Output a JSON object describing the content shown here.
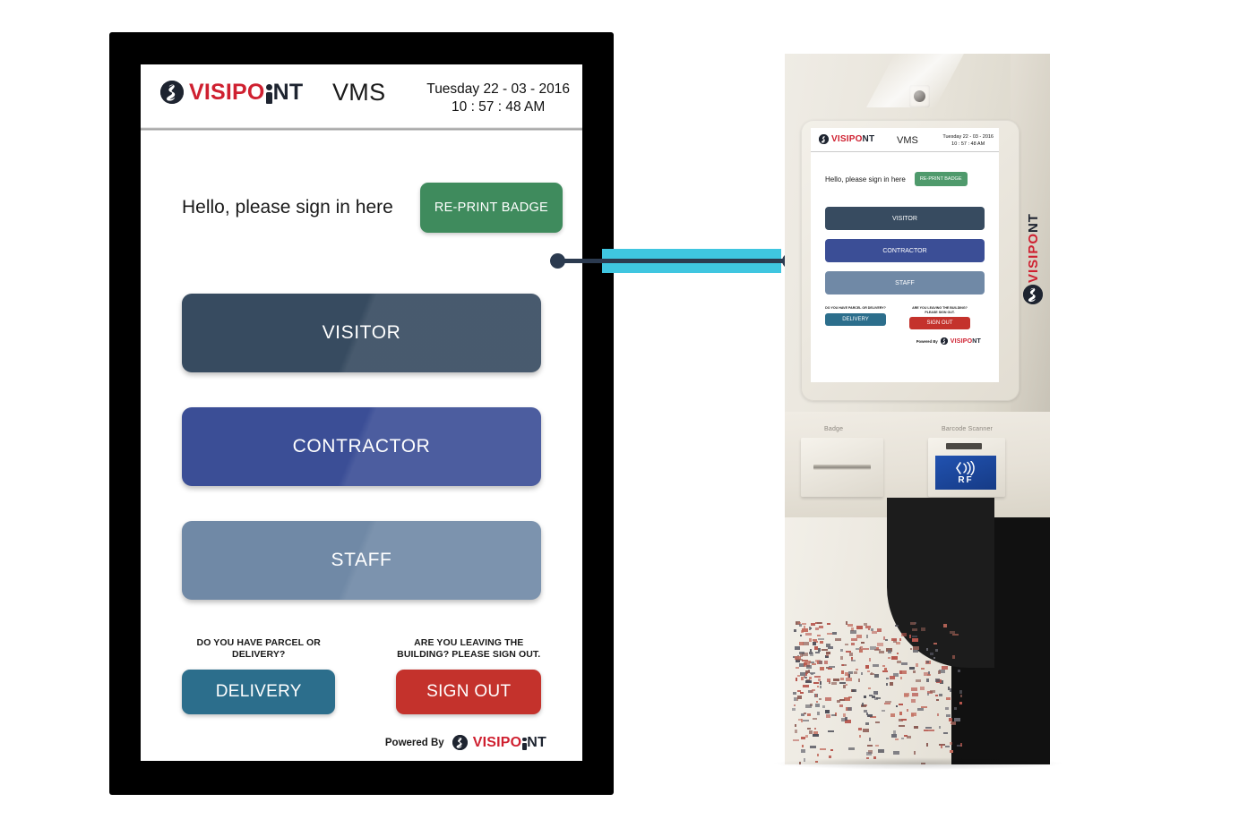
{
  "brand": {
    "name_part_red": "VISIPO",
    "name_part_i": "i",
    "name_part_dark": "NT",
    "full_name": "VISIPOINT",
    "logo_icon": "visipoint-person-badge-icon",
    "colors": {
      "red": "#cf2030",
      "dark": "#1e2430"
    }
  },
  "tablet_app": {
    "header": {
      "app_title": "VMS",
      "date": "Tuesday 22 - 03 - 2016",
      "time": "10 : 57 : 48  AM"
    },
    "greeting": {
      "text": "Hello, please sign in here",
      "reprint_button_label": "RE-PRINT BADGE",
      "reprint_button_color": "#3f8b5d"
    },
    "main_buttons": [
      {
        "label": "VISITOR",
        "color": "#374b60",
        "name": "visitor-button"
      },
      {
        "label": "CONTRACTOR",
        "color": "#3b4e96",
        "name": "contractor-button"
      },
      {
        "label": "STAFF",
        "color": "#7089a6",
        "name": "staff-button"
      }
    ],
    "bottom_actions": [
      {
        "prompt": "DO YOU HAVE PARCEL OR DELIVERY?",
        "label": "DELIVERY",
        "color": "#2c6e8c",
        "name": "delivery-button"
      },
      {
        "prompt": "ARE YOU LEAVING THE BUILDING? PLEASE SIGN OUT.",
        "label": "SIGN OUT",
        "color": "#c4322c",
        "name": "sign-out-button"
      }
    ],
    "footer": {
      "powered_by_label": "Powered By"
    }
  },
  "kiosk": {
    "brand_vertical_text": "VISIPOINT",
    "camera_icon": "camera-lens-icon",
    "slots": [
      {
        "label": "Badge",
        "name": "badge-printer-slot"
      },
      {
        "label": "Barcode Scanner",
        "name": "barcode-scanner-slot"
      }
    ],
    "rf_reader": {
      "label": "RF",
      "icon": "contactless-wave-icon",
      "color": "#1d4aa0"
    }
  },
  "callout": {
    "name": "callout-connector",
    "line_color": "#2b3a4f",
    "highlight_color": "#3fc6e0"
  }
}
